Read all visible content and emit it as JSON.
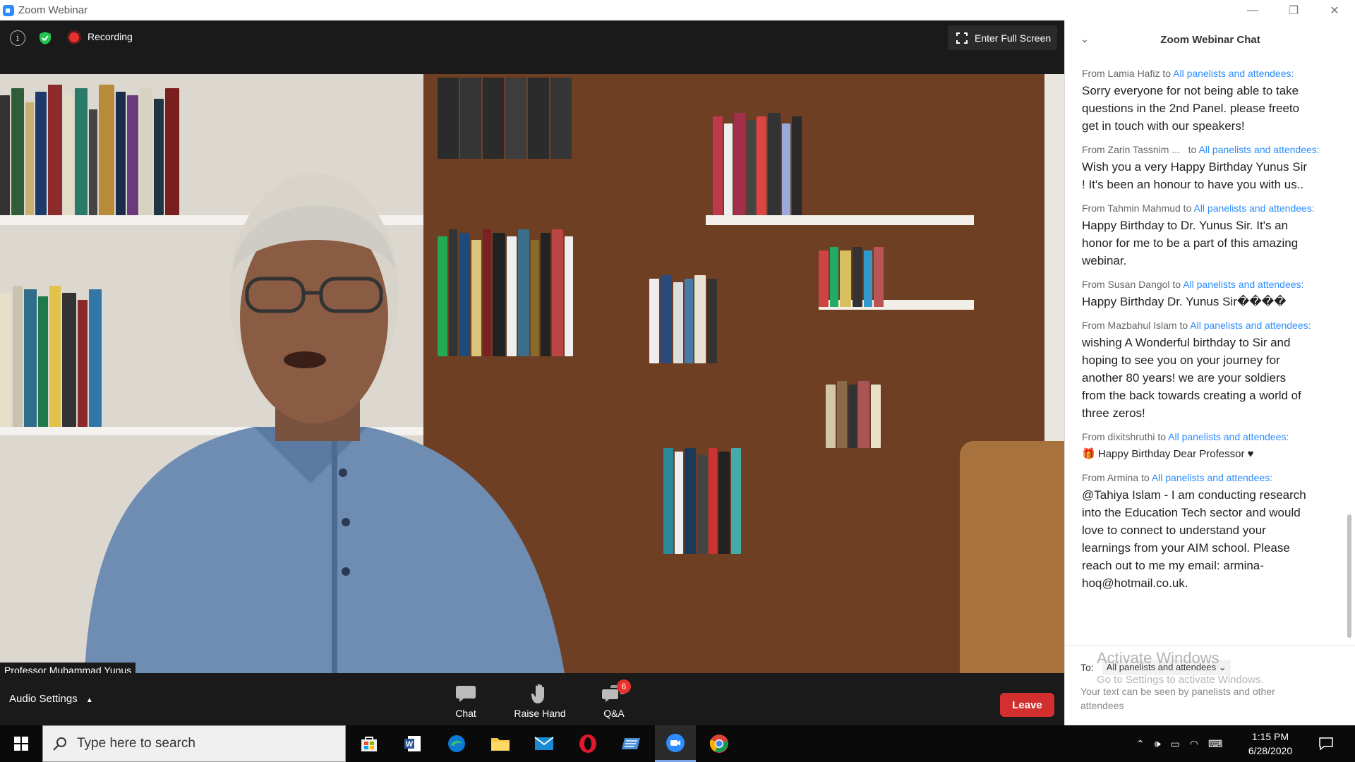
{
  "window": {
    "title": "Zoom Webinar"
  },
  "top_bar": {
    "recording_label": "Recording",
    "fullscreen_label": "Enter Full Screen"
  },
  "video": {
    "speaker_name": "Professor Muhammad Yunus"
  },
  "bottom_bar": {
    "audio_settings_label": "Audio Settings",
    "chat_label": "Chat",
    "raise_hand_label": "Raise Hand",
    "qa_label": "Q&A",
    "qa_badge": "6",
    "leave_label": "Leave"
  },
  "chat": {
    "title": "Zoom Webinar Chat",
    "messages": [
      {
        "from": "From Lamia Hafiz to ",
        "to": "All panelists and attendees:",
        "text": "Sorry everyone for not being able to take questions in the 2nd Panel. please freeto get in touch with our speakers!"
      },
      {
        "from": "From Zarin Tassnim ...   to ",
        "to": "All panelists and attendees:",
        "text": "Wish you a very Happy Birthday Yunus Sir ! It's been an honour to have you with us.."
      },
      {
        "from": "From Tahmin Mahmud to ",
        "to": "All panelists and attendees:",
        "text": "Happy Birthday to Dr. Yunus Sir. It's an honor for me to be a part of this amazing webinar."
      },
      {
        "from": "From Susan Dangol to ",
        "to": "All panelists and attendees:",
        "text": "Happy Birthday Dr. Yunus Sir����"
      },
      {
        "from": "From Mazbahul Islam to ",
        "to": "All panelists and attendees:",
        "text": "wishing A Wonderful birthday to Sir and hoping to see you on your journey for another 80 years! we are your soldiers from the back towards creating a world of three zeros!"
      },
      {
        "from": "From dixitshruthi to ",
        "to": "All panelists and attendees:",
        "text": "Happy Birthday Dear Professor"
      },
      {
        "from": "From Armina to ",
        "to": "All panelists and attendees:",
        "text": "@Tahiya Islam - I am conducting research into the Education Tech sector and would love to connect to understand your learnings from your AIM school. Please reach out to me my email: armina-hoq@hotmail.co.uk."
      }
    ],
    "to_label": "To:",
    "recipient": "All panelists and attendees",
    "hint": "Your text can be seen by panelists and other attendees",
    "activate_title": "Activate Windows",
    "activate_sub": "Go to Settings to activate Windows."
  },
  "taskbar": {
    "search_placeholder": "Type here to search",
    "time": "1:15 PM",
    "date": "6/28/2020"
  },
  "colors": {
    "accent": "#2d8cff",
    "leave": "#d32f2f",
    "recording": "#e8312a"
  }
}
